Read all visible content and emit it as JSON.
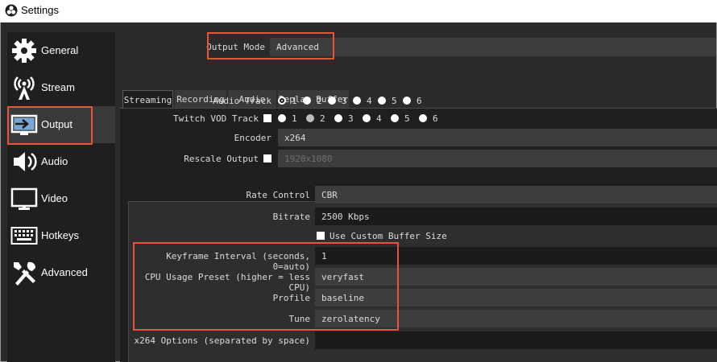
{
  "window": {
    "title": "Settings"
  },
  "sidebar": {
    "items": [
      {
        "label": "General",
        "icon": "gear-icon"
      },
      {
        "label": "Stream",
        "icon": "broadcast-tower-icon"
      },
      {
        "label": "Output",
        "icon": "output-monitor-icon"
      },
      {
        "label": "Audio",
        "icon": "speaker-icon"
      },
      {
        "label": "Video",
        "icon": "monitor-icon"
      },
      {
        "label": "Hotkeys",
        "icon": "keyboard-icon"
      },
      {
        "label": "Advanced",
        "icon": "tools-icon"
      }
    ],
    "active_index": 2
  },
  "output_mode": {
    "label": "Output Mode",
    "value": "Advanced"
  },
  "tabs": [
    {
      "label": "Streaming"
    },
    {
      "label": "Recording"
    },
    {
      "label": "Audio"
    },
    {
      "label": "Replay Buffer"
    }
  ],
  "streaming": {
    "audio_track": {
      "label": "Audio Track",
      "options": [
        "1",
        "2",
        "3",
        "4",
        "5",
        "6"
      ],
      "selected": "1"
    },
    "twitch_vod": {
      "label": "Twitch VOD Track",
      "options": [
        "1",
        "2",
        "3",
        "4",
        "5",
        "6"
      ],
      "selected": "2"
    },
    "encoder": {
      "label": "Encoder",
      "value": "x264"
    },
    "rescale": {
      "label": "Rescale Output",
      "value": "1920x1080"
    },
    "rate_control": {
      "label": "Rate Control",
      "value": "CBR"
    },
    "bitrate": {
      "label": "Bitrate",
      "value": "2500 Kbps"
    },
    "custom_buffer": {
      "label": "Use Custom Buffer Size"
    },
    "keyframe": {
      "label": "Keyframe Interval (seconds, 0=auto)",
      "value": "1"
    },
    "cpu_preset": {
      "label": "CPU Usage Preset (higher = less CPU)",
      "value": "veryfast"
    },
    "profile": {
      "label": "Profile",
      "value": "baseline"
    },
    "tune": {
      "label": "Tune",
      "value": "zerolatency"
    },
    "x264_options": {
      "label": "x264 Options (separated by space)",
      "value": ""
    }
  },
  "colors": {
    "highlight": "#e8533a",
    "background": "#2b2b2b",
    "sidebar": "#1f1f1f",
    "field": "#3d3d3d"
  }
}
